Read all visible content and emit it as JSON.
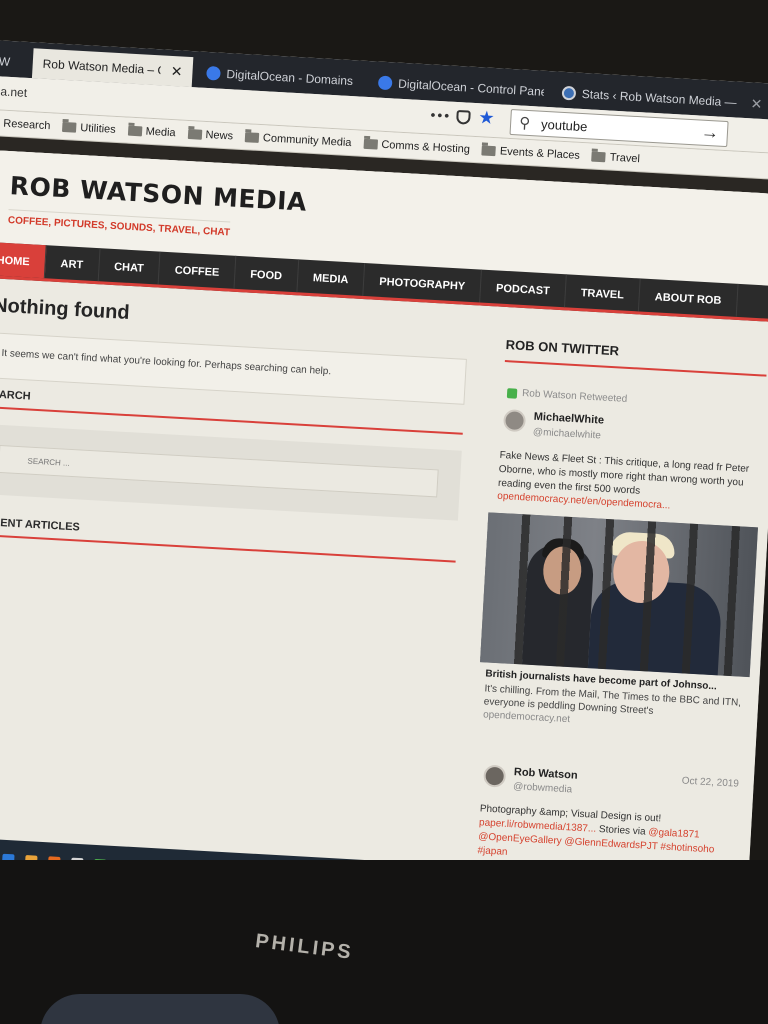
{
  "browser": {
    "tabs": [
      {
        "label": "W",
        "active": false
      },
      {
        "label": "Rob Watson Media – Coffee, Pictur",
        "active": true
      },
      {
        "label": "DigitalOcean - Domains",
        "active": false
      },
      {
        "label": "DigitalOcean - Control Panel",
        "active": false
      },
      {
        "label": "Stats ‹ Rob Watson Media —",
        "active": false
      }
    ],
    "url": "dia.net",
    "search_value": "youtube",
    "bookmarks": [
      "Research",
      "Utilities",
      "Media",
      "News",
      "Community Media",
      "Comms & Hosting",
      "Events & Places",
      "Travel"
    ]
  },
  "site": {
    "title": "ROB WATSON MEDIA",
    "tagline": "COFFEE, PICTURES, SOUNDS, TRAVEL, CHAT",
    "nav": [
      "HOME",
      "ART",
      "CHAT",
      "COFFEE",
      "FOOD",
      "MEDIA",
      "PHOTOGRAPHY",
      "PODCAST",
      "TRAVEL",
      "ABOUT ROB"
    ],
    "accent_color": "#d9403a",
    "main": {
      "heading": "Nothing found",
      "message": "It seems we can't find what you're looking for. Perhaps searching can help.",
      "search_title": "SEARCH",
      "search_placeholder": "SEARCH ...",
      "recent_title": "RECENT ARTICLES"
    },
    "sidebar": {
      "title": "ROB ON TWITTER",
      "retweet_label": "Rob Watson Retweeted",
      "tweet1": {
        "name": "MichaelWhite",
        "handle": "@michaelwhite",
        "text": "Fake News & Fleet St : This critique, a long read fr Peter Oborne, who is mostly more right than wrong worth you reading even the first 500 words",
        "link": "opendemocracy.net/en/opendemocra..."
      },
      "card": {
        "title": "British journalists have become part of Johnso...",
        "desc": "It's chilling. From the Mail, The Times to the BBC and ITN, everyone is peddling Downing Street's",
        "domain": "opendemocracy.net"
      },
      "tweet2": {
        "name": "Rob Watson",
        "handle": "@robwmedia",
        "date": "Oct 22, 2019",
        "text_plain": "Photography &amp; Visual Design is out!",
        "text_links": "paper.li/robwmedia/1387...",
        "text_mid": " Stories via ",
        "text_mentions": "@gala1871 @OpenEyeGallery @GlennEdwardsPJT #shotinsoho #japan"
      }
    }
  },
  "monitor": {
    "brand": "PHILIPS"
  }
}
